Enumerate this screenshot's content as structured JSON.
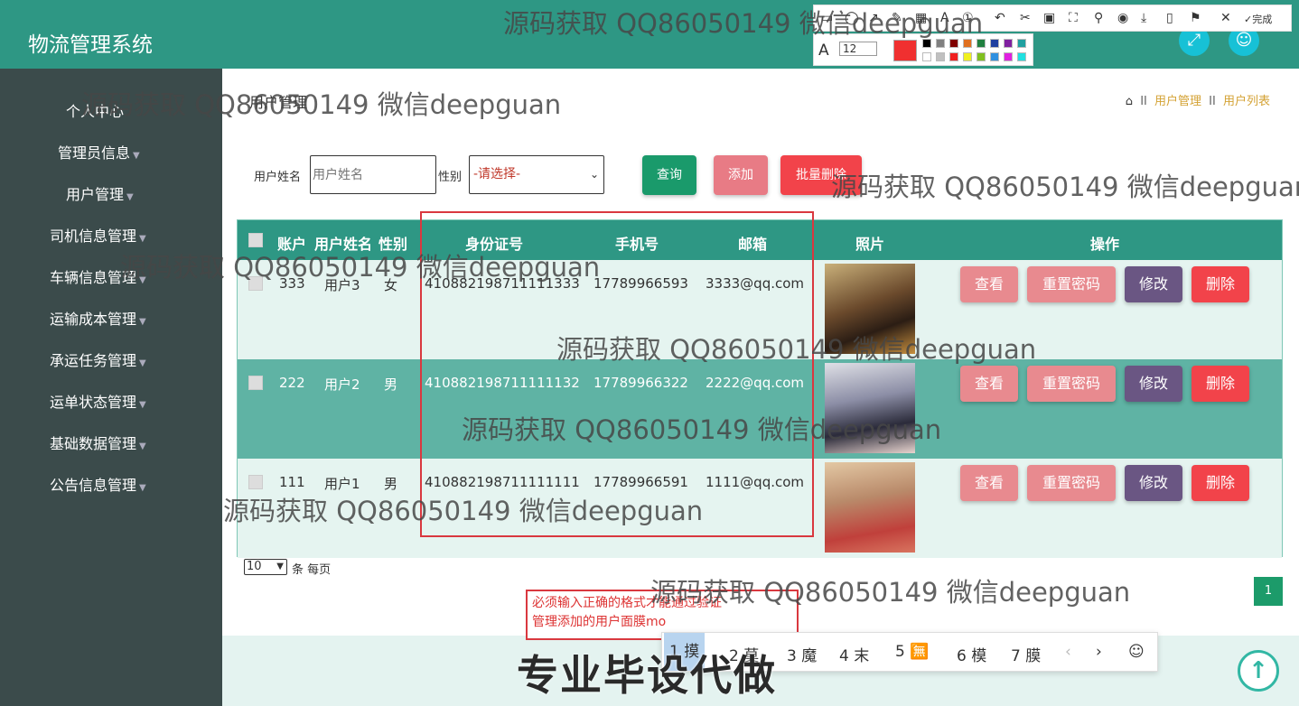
{
  "app": {
    "title": "物流管理系统"
  },
  "sidebar": {
    "items": [
      {
        "label": "个人中心"
      },
      {
        "label": "管理员信息"
      },
      {
        "label": "用户管理"
      },
      {
        "label": "司机信息管理"
      },
      {
        "label": "车辆信息管理"
      },
      {
        "label": "运输成本管理"
      },
      {
        "label": "承运任务管理"
      },
      {
        "label": "运单状态管理"
      },
      {
        "label": "基础数据管理"
      },
      {
        "label": "公告信息管理"
      }
    ]
  },
  "page": {
    "title": "用户管理",
    "breadcrumb": {
      "sep": "II",
      "items": [
        "用户管理",
        "用户列表"
      ]
    }
  },
  "search": {
    "name_label": "用户姓名",
    "name_placeholder": "用户姓名",
    "gender_label": "性别",
    "gender_selected": "-请选择-",
    "query_label": "查询",
    "add_label": "添加",
    "batch_delete_label": "批量删除"
  },
  "table": {
    "headers": [
      "账户",
      "用户姓名",
      "性别",
      "身份证号",
      "手机号",
      "邮箱",
      "照片",
      "操作"
    ],
    "rows": [
      {
        "account": "333",
        "name": "用户3",
        "gender": "女",
        "id_number": "410882198711111333",
        "phone": "17789966593",
        "email": "3333@qq.com"
      },
      {
        "account": "222",
        "name": "用户2",
        "gender": "男",
        "id_number": "410882198711111132",
        "phone": "17789966322",
        "email": "2222@qq.com"
      },
      {
        "account": "111",
        "name": "用户1",
        "gender": "男",
        "id_number": "410882198711111111",
        "phone": "17789966591",
        "email": "1111@qq.com"
      }
    ],
    "actions": {
      "view": "查看",
      "reset_password": "重置密码",
      "edit": "修改",
      "delete": "删除"
    }
  },
  "pager": {
    "page_size": "10",
    "per_page_label": "条 每页",
    "current_page": "1"
  },
  "annotation": {
    "line1": "必须输入正确的格式才能通过验证",
    "line2": "管理添加的用户面膜mo",
    "toolbar_done": "完成",
    "font_size": "12"
  },
  "ime": {
    "candidates": [
      "1 摸",
      "2 莫",
      "3 魔",
      "4 末",
      "5 🈚",
      "6 模",
      "7 膜"
    ]
  },
  "watermark": "源码获取 QQ86050149 微信deepguan",
  "banner": "专业毕设代做",
  "colors": {
    "primary": "#2e9784",
    "sidebar": "#3b4b4b",
    "view_btn": "#e88a8f",
    "edit_btn": "#6a5683",
    "delete_btn": "#f2434a",
    "query_btn": "#1a9a6b",
    "add_btn": "#e87b85",
    "batch_btn": "#f2434a"
  }
}
